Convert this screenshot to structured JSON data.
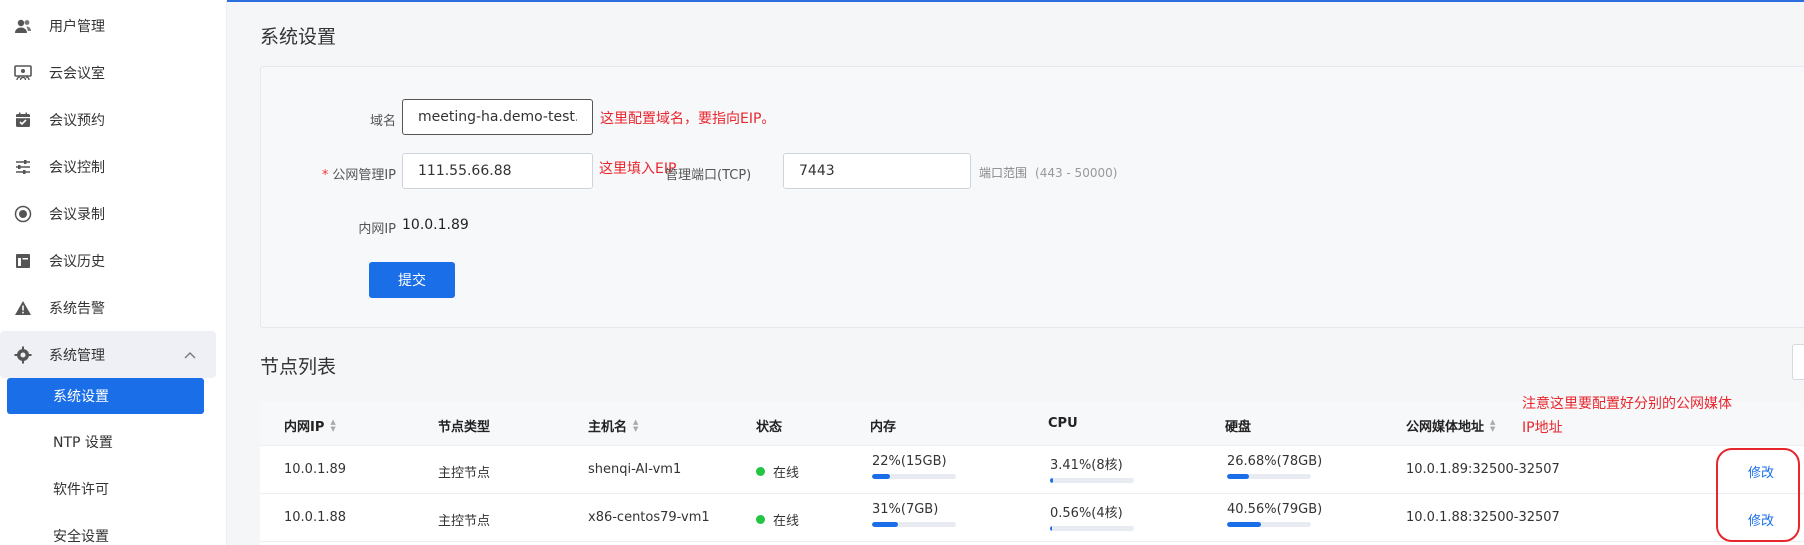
{
  "sidebar": {
    "items": [
      {
        "label": "用户管理",
        "icon": "users-icon"
      },
      {
        "label": "云会议室",
        "icon": "meeting-room-icon"
      },
      {
        "label": "会议预约",
        "icon": "calendar-icon"
      },
      {
        "label": "会议控制",
        "icon": "sliders-icon"
      },
      {
        "label": "会议录制",
        "icon": "record-icon"
      },
      {
        "label": "会议历史",
        "icon": "history-icon"
      },
      {
        "label": "系统告警",
        "icon": "warning-icon"
      }
    ],
    "group": {
      "label": "系统管理",
      "icon": "gear-icon",
      "expanded": true
    },
    "sub_items": [
      {
        "label": "系统设置",
        "active": true
      },
      {
        "label": "NTP 设置",
        "active": false
      },
      {
        "label": "软件许可",
        "active": false
      },
      {
        "label": "安全设置",
        "active": false
      }
    ]
  },
  "page": {
    "title": "系统设置"
  },
  "form": {
    "domain_label": "域名",
    "domain_value": "meeting-ha.demo-test.com",
    "domain_note": "这里配置域名，要指向EIP。",
    "public_ip_label": "公网管理IP",
    "public_ip_required": "*",
    "public_ip_value": "111.55.66.88",
    "public_ip_note": "这里填入EIP",
    "port_label": "管理端口(TCP)",
    "port_value": "7443",
    "port_hint": "端口范围",
    "port_range": "(443 - 50000)",
    "internal_ip_label": "内网IP",
    "internal_ip_value": "10.0.1.89",
    "submit_label": "提交"
  },
  "nodes": {
    "title": "节点列表",
    "note": "注意这里要配置好分别的公网媒体IP地址",
    "columns": [
      "内网IP",
      "节点类型",
      "主机名",
      "状态",
      "内存",
      "CPU",
      "硬盘",
      "公网媒体地址"
    ],
    "rows": [
      {
        "ip": "10.0.1.89",
        "type": "主控节点",
        "host": "shenqi-AI-vm1",
        "status": "在线",
        "mem": "22%(15GB)",
        "mem_pct": 22,
        "cpu": "3.41%(8核)",
        "cpu_pct": 3.41,
        "disk": "26.68%(78GB)",
        "disk_pct": 26.68,
        "media": "10.0.1.89:32500-32507",
        "action": "修改"
      },
      {
        "ip": "10.0.1.88",
        "type": "主控节点",
        "host": "x86-centos79-vm1",
        "status": "在线",
        "mem": "31%(7GB)",
        "mem_pct": 31,
        "cpu": "0.56%(4核)",
        "cpu_pct": 0.56,
        "disk": "40.56%(79GB)",
        "disk_pct": 40.56,
        "media": "10.0.1.88:32500-32507",
        "action": "修改"
      }
    ]
  },
  "colors": {
    "primary": "#1a6ee8",
    "annotation": "#e8262d",
    "online": "#23c343"
  }
}
